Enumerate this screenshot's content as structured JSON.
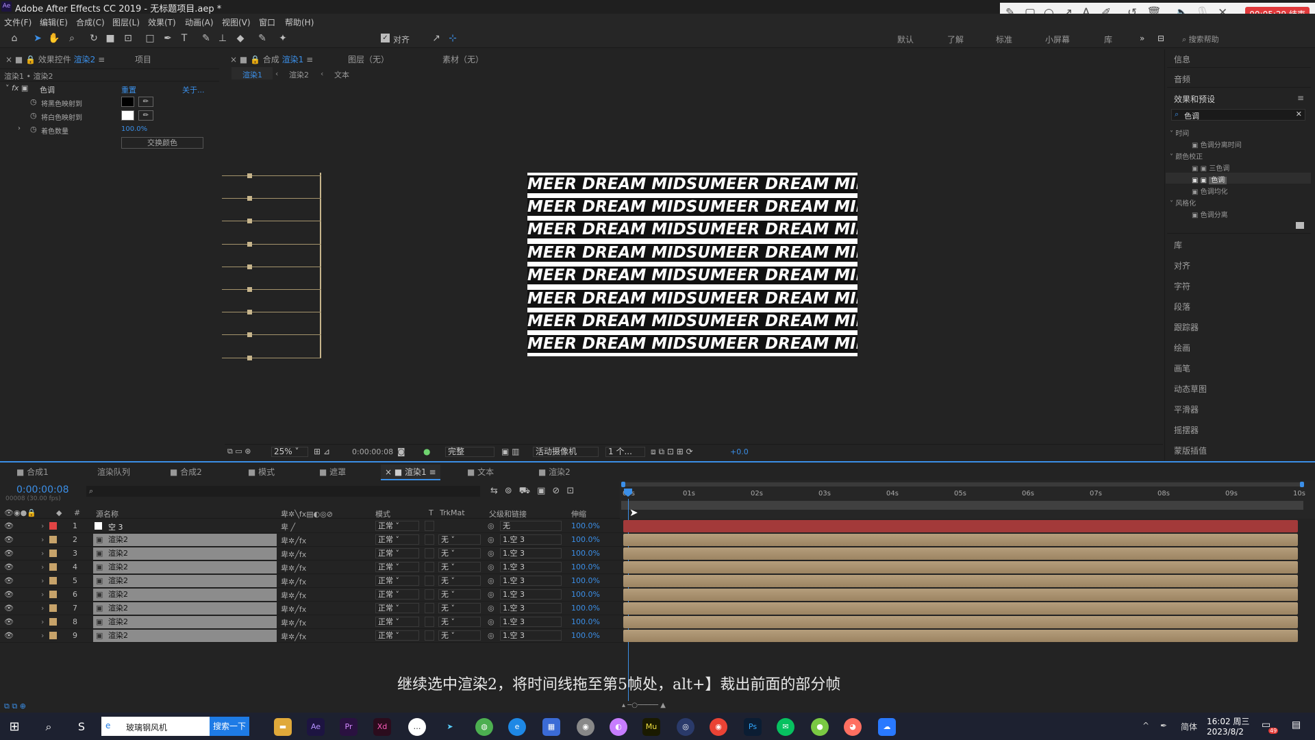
{
  "window_title": "Adobe After Effects CC 2019 - 无标题项目.aep *",
  "app_badge": "Ae",
  "menu": [
    "文件(F)",
    "编辑(E)",
    "合成(C)",
    "图层(L)",
    "效果(T)",
    "动画(A)",
    "视图(V)",
    "窗口",
    "帮助(H)"
  ],
  "toolbar": {
    "align_label": "对齐",
    "workspaces": [
      "默认",
      "了解",
      "标准",
      "小屏幕",
      "库"
    ],
    "search_help": "搜索帮助"
  },
  "recorder": {
    "timer": "00:05:29 结束"
  },
  "effects_panel": {
    "tab_label": "效果控件",
    "tab_target": "渲染2",
    "tab_project": "项目",
    "breadcrumb": "渲染1 • 渲染2",
    "effect_name": "色调",
    "reset": "重置",
    "about": "关于...",
    "props": [
      {
        "name": "将黑色映射到"
      },
      {
        "name": "将白色映射到"
      },
      {
        "name": "着色数量",
        "value": "100.0%"
      }
    ],
    "swap_button": "交换颜色"
  },
  "viewer": {
    "tab_comp": "合成",
    "tab_comp_target": "渲染1",
    "tab_layer": "图层（无）",
    "tab_footage": "素材（无）",
    "crumbs": [
      "渲染1",
      "渲染2",
      "文本"
    ],
    "text_line": "MEER DREAM MIDSUMEER DREAM MIDSUMEER",
    "zoom": "25%",
    "timecode": "0:00:00:08",
    "quality": "完整",
    "camera": "活动摄像机",
    "views": "1 个...",
    "exposure": "+0.0"
  },
  "right_panel": {
    "info": "信息",
    "audio": "音频",
    "effects_presets": "效果和预设",
    "search_value": "色调",
    "tree": [
      {
        "label": "时间",
        "type": "folder"
      },
      {
        "label": "色调分离时间",
        "type": "item"
      },
      {
        "label": "颜色校正",
        "type": "folder"
      },
      {
        "label": "三色调",
        "type": "item"
      },
      {
        "label": "色调",
        "type": "item-selected"
      },
      {
        "label": "色调均化",
        "type": "item"
      },
      {
        "label": "风格化",
        "type": "folder"
      },
      {
        "label": "色调分离",
        "type": "item"
      }
    ],
    "panels": [
      "库",
      "对齐",
      "字符",
      "段落",
      "跟踪器",
      "绘画",
      "画笔",
      "动态草图",
      "平滑器",
      "摇摆器",
      "蒙版插值"
    ]
  },
  "timeline": {
    "tabs": [
      {
        "label": "合成1"
      },
      {
        "label": "渲染队列"
      },
      {
        "label": "合成2"
      },
      {
        "label": "模式"
      },
      {
        "label": "遮罩"
      },
      {
        "label": "渲染1",
        "active": true
      },
      {
        "label": "文本"
      },
      {
        "label": "渲染2"
      }
    ],
    "timecode": "0:00:00:08",
    "frame_info": "00008 (30.00 fps)",
    "headers": {
      "source": "源名称",
      "mode": "模式",
      "t": "T",
      "trkmat": "TrkMat",
      "parent": "父级和链接",
      "stretch": "伸缩"
    },
    "ruler": [
      "00s",
      "01s",
      "02s",
      "03s",
      "04s",
      "05s",
      "06s",
      "07s",
      "08s",
      "09s",
      "10s"
    ],
    "layers": [
      {
        "num": "1",
        "name": "空 3",
        "mode": "正常",
        "trkmat": "",
        "parent": "无",
        "stretch": "100.0%",
        "color": "#e24444"
      },
      {
        "num": "2",
        "name": "渲染2",
        "mode": "正常",
        "trkmat": "无",
        "parent": "1.空 3",
        "stretch": "100.0%",
        "color": "#c7a36a"
      },
      {
        "num": "3",
        "name": "渲染2",
        "mode": "正常",
        "trkmat": "无",
        "parent": "1.空 3",
        "stretch": "100.0%",
        "color": "#c7a36a"
      },
      {
        "num": "4",
        "name": "渲染2",
        "mode": "正常",
        "trkmat": "无",
        "parent": "1.空 3",
        "stretch": "100.0%",
        "color": "#c7a36a"
      },
      {
        "num": "5",
        "name": "渲染2",
        "mode": "正常",
        "trkmat": "无",
        "parent": "1.空 3",
        "stretch": "100.0%",
        "color": "#c7a36a"
      },
      {
        "num": "6",
        "name": "渲染2",
        "mode": "正常",
        "trkmat": "无",
        "parent": "1.空 3",
        "stretch": "100.0%",
        "color": "#c7a36a"
      },
      {
        "num": "7",
        "name": "渲染2",
        "mode": "正常",
        "trkmat": "无",
        "parent": "1.空 3",
        "stretch": "100.0%",
        "color": "#c7a36a"
      },
      {
        "num": "8",
        "name": "渲染2",
        "mode": "正常",
        "trkmat": "无",
        "parent": "1.空 3",
        "stretch": "100.0%",
        "color": "#c7a36a"
      },
      {
        "num": "9",
        "name": "渲染2",
        "mode": "正常",
        "trkmat": "无",
        "parent": "1.空 3",
        "stretch": "100.0%",
        "color": "#c7a36a"
      }
    ],
    "subtitle": "继续选中渲染2，将时间线拖至第5帧处，alt+】裁出前面的部分帧"
  },
  "taskbar": {
    "browser_label": "玻璃钢风机",
    "search_btn": "搜索一下",
    "time": "16:02 周三",
    "date": "2023/8/2",
    "ime": "简体",
    "notif_count": "49"
  }
}
